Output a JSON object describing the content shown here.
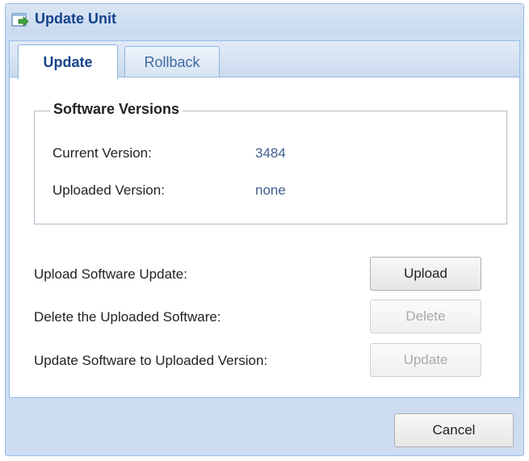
{
  "window": {
    "title": "Update Unit",
    "title_icon": "update-arrow-icon"
  },
  "tabs": [
    {
      "label": "Update",
      "active": true
    },
    {
      "label": "Rollback",
      "active": false
    }
  ],
  "software_versions": {
    "legend": "Software Versions",
    "current_label": "Current Version:",
    "current_value": "3484",
    "uploaded_label": "Uploaded Version:",
    "uploaded_value": "none"
  },
  "actions": {
    "upload_label": "Upload Software Update:",
    "upload_button": "Upload",
    "delete_label": "Delete the Uploaded Software:",
    "delete_button": "Delete",
    "update_label": "Update Software to Uploaded Version:",
    "update_button": "Update"
  },
  "footer": {
    "cancel_button": "Cancel"
  },
  "colors": {
    "title_text": "#15428b",
    "value_text": "#3f5f8f",
    "frame_border": "#99bbe8"
  }
}
